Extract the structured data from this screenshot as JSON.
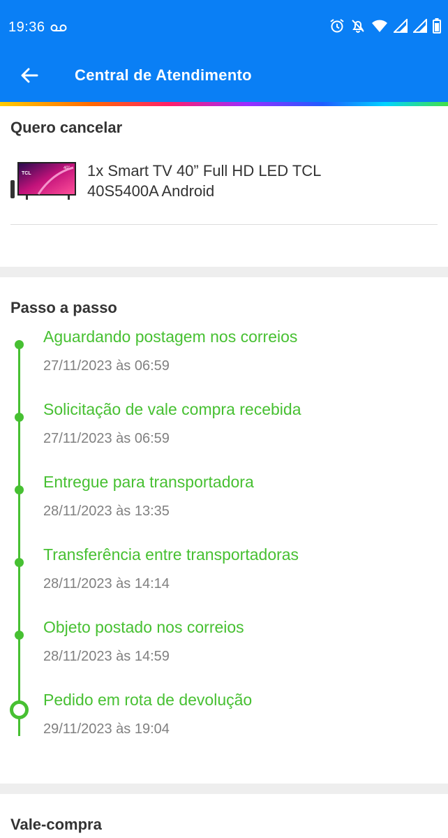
{
  "status_bar": {
    "time": "19:36",
    "icons": [
      "voicemail-icon",
      "alarm-icon",
      "bell-off-icon",
      "wifi-icon",
      "signal-icon",
      "signal-icon",
      "battery-icon"
    ]
  },
  "app_bar": {
    "title": "Central de Atendimento",
    "back_icon": "arrow-left-icon",
    "background": "#0a7ff5"
  },
  "cancel_section": {
    "title": "Quero cancelar",
    "product": {
      "name": "1x Smart TV 40” Full HD LED TCL 40S5400A Android",
      "thumbnail_text": "TCL",
      "thumbnail_size_label": "40\""
    }
  },
  "steps_section": {
    "title": "Passo a passo",
    "accent_color": "#47c032",
    "steps": [
      {
        "title": "Aguardando postagem nos correios",
        "date": "27/11/2023 às 06:59"
      },
      {
        "title": "Solicitação de vale compra recebida",
        "date": "27/11/2023 às 06:59"
      },
      {
        "title": "Entregue para transportadora",
        "date": "28/11/2023 às 13:35"
      },
      {
        "title": "Transferência entre transportadoras",
        "date": "28/11/2023 às 14:14"
      },
      {
        "title": "Objeto postado nos correios",
        "date": "28/11/2023 às 14:59"
      },
      {
        "title": "Pedido em rota de devolução",
        "date": "29/11/2023 às 19:04",
        "current": true
      }
    ]
  },
  "voucher_section": {
    "title": "Vale-compra"
  }
}
